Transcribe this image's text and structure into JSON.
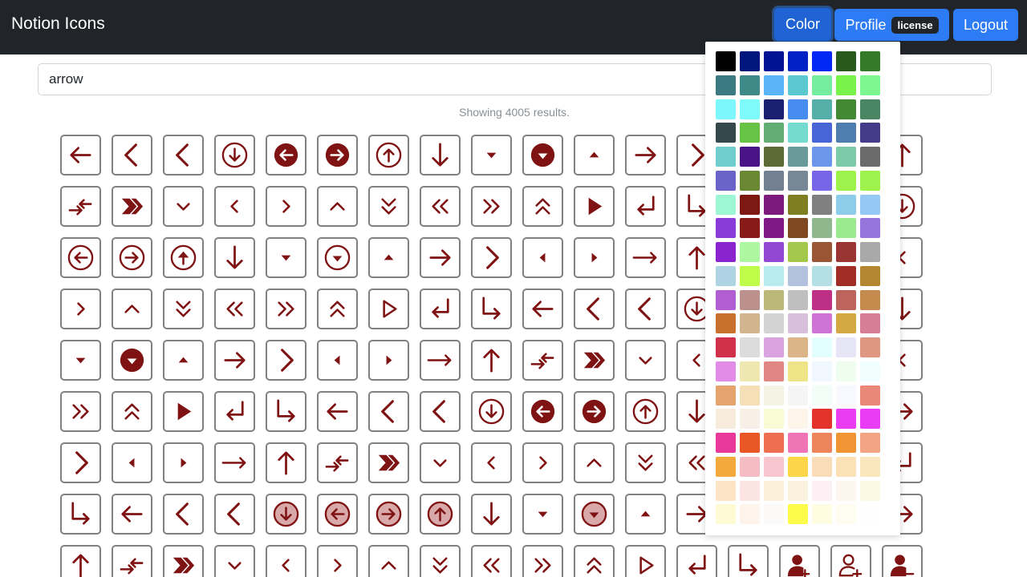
{
  "app": {
    "title": "Notion Icons"
  },
  "nav": {
    "color_label": "Color",
    "profile_label": "Profile",
    "license_badge": "license",
    "logout_label": "Logout"
  },
  "search": {
    "value": "arrow"
  },
  "results_text": "Showing 4005 results.",
  "icon_color": "#7f1212",
  "icons": [
    [
      "arrow-left",
      "chevron-left-thin",
      "chevron-left-thin",
      "arrow-down-circle",
      "arrow-left-circle-filled",
      "arrow-right-circle-filled",
      "arrow-up-circle",
      "arrow-down",
      "caret-down",
      "caret-down-circle-filled",
      "caret-up",
      "arrow-right",
      "chevron-right-thin",
      "",
      "",
      "",
      "arrow-up"
    ],
    [
      "arrows-exchange",
      "chevron-double-right-bold",
      "chevron-down-small",
      "chevron-left-small",
      "chevron-right-small",
      "chevron-up-small",
      "chevron-double-down",
      "chevron-double-left",
      "chevron-double-right",
      "chevron-double-up",
      "play-filled",
      "return-left",
      "turn-down-right",
      "",
      "",
      "",
      "arrow-down-circle"
    ],
    [
      "arrow-left-circle",
      "arrow-right-circle",
      "arrow-up-circle-bold",
      "arrow-down",
      "caret-down",
      "caret-down-circle",
      "caret-up",
      "arrow-right",
      "chevron-right-thin",
      "caret-left",
      "caret-right",
      "arrow-right-long",
      "arrow-up",
      "",
      "",
      "",
      "chevron-left-small"
    ],
    [
      "chevron-right-small",
      "chevron-up-small",
      "chevron-double-down",
      "chevron-double-left",
      "chevron-double-right",
      "chevron-double-up",
      "play-outline",
      "return-left",
      "turn-down-right",
      "arrow-left",
      "chevron-left-thin",
      "chevron-left-thin",
      "arrow-down-circle",
      "",
      "",
      "",
      "arrow-down"
    ],
    [
      "caret-down",
      "caret-down-circle-filled",
      "caret-up",
      "arrow-right",
      "chevron-right-thin",
      "caret-left",
      "caret-right",
      "arrow-right-long",
      "arrow-up",
      "arrows-exchange",
      "chevron-double-right-bold",
      "chevron-down-small",
      "chevron-left-small",
      "",
      "",
      "",
      "chevron-left-small"
    ],
    [
      "chevron-double-right",
      "chevron-double-up",
      "play-filled",
      "return-left",
      "turn-down-right",
      "arrow-left",
      "chevron-left-thin",
      "chevron-left-thin",
      "arrow-down-circle",
      "arrow-left-circle-filled",
      "arrow-right-circle-filled",
      "arrow-up-circle",
      "arrow-down",
      "",
      "",
      "",
      "arrow-right"
    ],
    [
      "chevron-right-thin",
      "caret-left",
      "caret-right",
      "arrow-right-long",
      "arrow-up",
      "arrows-exchange",
      "chevron-double-right-bold",
      "chevron-down-small",
      "chevron-left-small",
      "chevron-right-small",
      "chevron-up-small",
      "chevron-double-down",
      "chevron-double-left",
      "",
      "",
      "",
      "return-left"
    ],
    [
      "turn-down-right",
      "arrow-left",
      "chevron-left-thin",
      "chevron-left-thin",
      "arrow-down-circle-tinted",
      "arrow-left-circle-tinted",
      "arrow-right-circle-tinted",
      "arrow-up-circle-tinted",
      "arrow-down",
      "caret-down",
      "caret-down-circle-tinted",
      "caret-up",
      "arrow-right",
      "",
      "",
      "",
      "arrow-right"
    ],
    [
      "arrow-up",
      "arrows-exchange",
      "chevron-double-right-bold",
      "chevron-down-small",
      "chevron-left-small",
      "chevron-right-small",
      "chevron-up-small",
      "chevron-double-down",
      "chevron-double-left",
      "chevron-double-right",
      "chevron-double-up",
      "play-outline",
      "return-left",
      "turn-down-right",
      "user-add",
      "user-add-outline",
      "user-remove"
    ]
  ],
  "color_palette": [
    [
      "#000000",
      "#00157e",
      "#001393",
      "#0022c4",
      "#0027f4",
      "#275a1c",
      "#357b27"
    ],
    [
      "#3b7a80",
      "#3e8a88",
      "#5ab5f8",
      "#5cc8d0",
      "#76ed9e",
      "#79f24a",
      "#7ef68f"
    ],
    [
      "#7ef7fc",
      "#7efafa",
      "#1a1f6f",
      "#478cef",
      "#55aea8",
      "#438832",
      "#4a8664"
    ],
    [
      "#35494c",
      "#67c346",
      "#62ad72",
      "#75dbd0",
      "#4765d7",
      "#4f7db0",
      "#453b8a"
    ],
    [
      "#70cdcd",
      "#4a1487",
      "#5a6c33",
      "#6b9a9b",
      "#6b96ea",
      "#7dcaa8",
      "#6b6b6b"
    ],
    [
      "#6a64c8",
      "#6a8834",
      "#738091",
      "#788796",
      "#7767e8",
      "#9ef24c",
      "#9ef24c"
    ],
    [
      "#9ef7d4",
      "#7d1812",
      "#7d1a7d",
      "#7f7f22",
      "#808080",
      "#8ecdea",
      "#95c9f5"
    ],
    [
      "#8a3cd8",
      "#881a18",
      "#801886",
      "#804820",
      "#8fb78e",
      "#9bea8f",
      "#9676dc"
    ],
    [
      "#8b24cf",
      "#acf7a0",
      "#9248d2",
      "#a3c84b",
      "#9a5634",
      "#9a3534",
      "#a9a9a9"
    ],
    [
      "#aed4e3",
      "#bffc4a",
      "#b8ecee",
      "#b2c1de",
      "#b4dfe4",
      "#a12d27",
      "#b3862f"
    ],
    [
      "#b15ed2",
      "#bc918d",
      "#bcb87a",
      "#bfbfbf",
      "#be2f86",
      "#bd655d",
      "#c58a4d"
    ],
    [
      "#c8702d",
      "#d2b58f",
      "#d3d3d3",
      "#d7c0da",
      "#d073d6",
      "#d4a843",
      "#d57e96"
    ],
    [
      "#d1304a",
      "#dcdcdc",
      "#dba2e0",
      "#dbb487",
      "#e2fefe",
      "#e6e6f7",
      "#e09781"
    ],
    [
      "#e28ce7",
      "#eee8b0",
      "#e08683",
      "#efe487",
      "#f0f7fe",
      "#effdee",
      "#f0fefe"
    ],
    [
      "#e5a46e",
      "#f4dfb6",
      "#f3f4e3",
      "#f5f5f5",
      "#f3fdf8",
      "#f8f8ff",
      "#e98878"
    ],
    [
      "#f7ebdc",
      "#f8f0e6",
      "#f8fcd4",
      "#fef5ea",
      "#e4332b",
      "#ea3cf1",
      "#e93cf7"
    ],
    [
      "#e8399a",
      "#ea5726",
      "#ee6e52",
      "#ef75b7",
      "#ee855a",
      "#f19534",
      "#f2a483"
    ],
    [
      "#f4a93c",
      "#f6bcc3",
      "#f7c6cf",
      "#fcd548",
      "#fbdcb8",
      "#fbe1b5",
      "#fbe7bd"
    ],
    [
      "#fce4c5",
      "#fce4e2",
      "#fdf0da",
      "#faf1df",
      "#fdf0f5",
      "#fcf6ee",
      "#fdf8e4"
    ],
    [
      "#fefad3",
      "#fef4eb",
      "#fcf9f9",
      "#fefc4a",
      "#fefde1",
      "#fefdf0",
      "#fefefe"
    ]
  ]
}
